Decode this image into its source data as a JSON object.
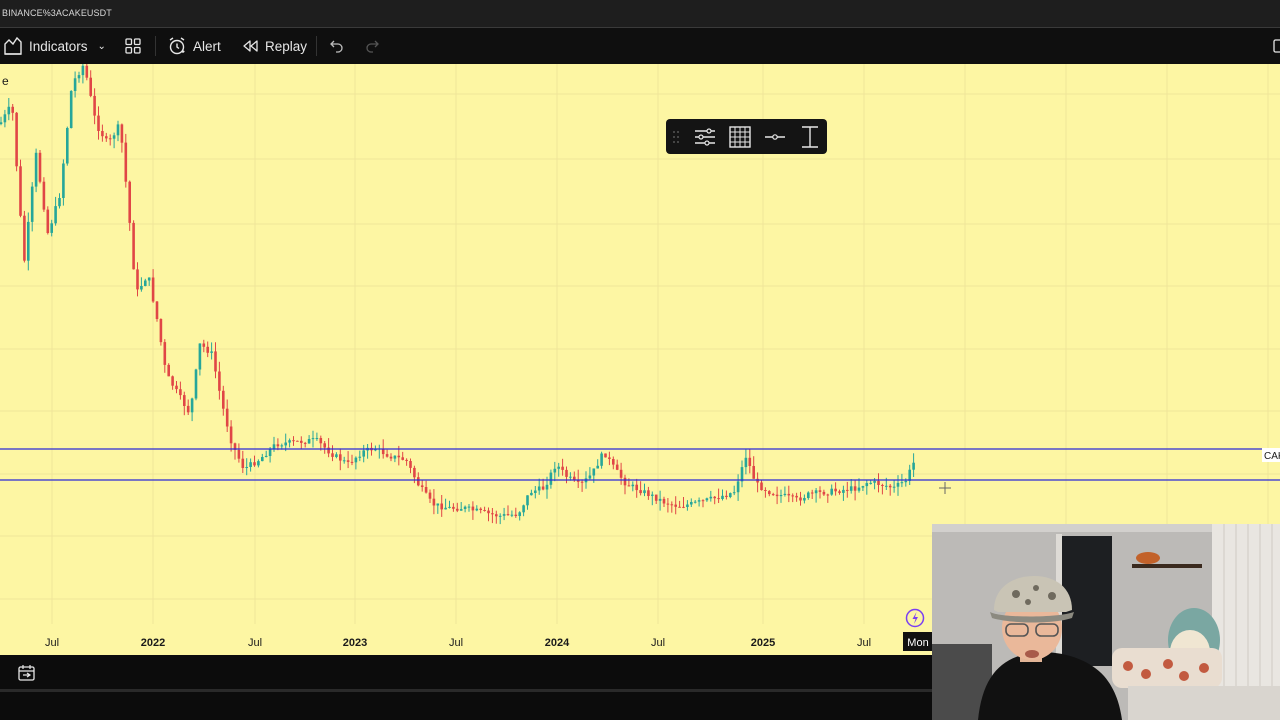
{
  "window": {
    "symbol_title": "BINANCE%3ACAKEUSDT"
  },
  "toolbar": {
    "indicators_label": "Indicators",
    "alert_label": "Alert",
    "replay_label": "Replay"
  },
  "chart": {
    "axis_label_left": "e",
    "price_tag": "CAK",
    "time_axis": [
      "Jul",
      "2022",
      "Jul",
      "2023",
      "Jul",
      "2024",
      "Jul",
      "2025",
      "Jul"
    ],
    "current_time_label": "Mon",
    "background_color": "#fdf6a3",
    "up_color": "#26a69a",
    "down_color": "#e04646",
    "level_line_color": "#2b2bd6"
  },
  "floating_toolbar": {
    "icons": [
      "drag-handle-icon",
      "settings-lines-icon",
      "grid-icon",
      "horizontal-line-icon",
      "vertical-ruler-icon"
    ]
  }
}
